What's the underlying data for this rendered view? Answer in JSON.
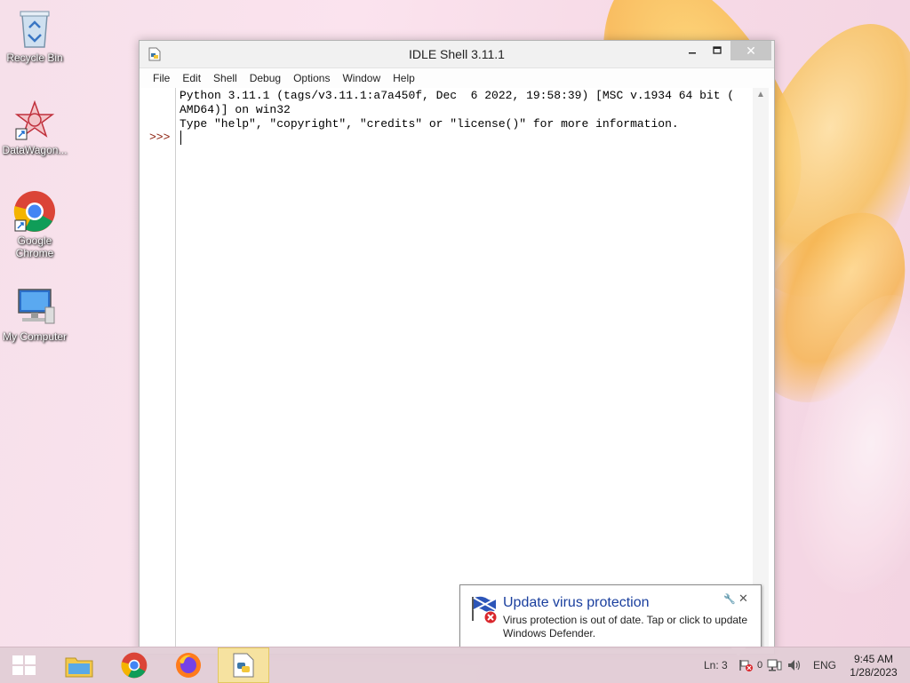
{
  "desktop": {
    "icons": [
      {
        "label": "Recycle Bin"
      },
      {
        "label": "DataWagon..."
      },
      {
        "label": "Google Chrome"
      },
      {
        "label": "My Computer"
      }
    ]
  },
  "window": {
    "title": "IDLE Shell 3.11.1",
    "menu": [
      "File",
      "Edit",
      "Shell",
      "Debug",
      "Options",
      "Window",
      "Help"
    ],
    "lines": [
      "Python 3.11.1 (tags/v3.11.1:a7a450f, Dec  6 2022, 19:58:39) [MSC v.1934 64 bit (",
      "AMD64)] on win32",
      "Type \"help\", \"copyright\", \"credits\" or \"license()\" for more information."
    ],
    "prompt": ">>>"
  },
  "notification": {
    "title": "Update virus protection",
    "body": "Virus protection is out of date. Tap or click to update Windows Defender."
  },
  "taskbar": {
    "status_text": "Ln: 3",
    "tray_count": "0",
    "language": "ENG",
    "time": "9:45 AM",
    "date": "1/28/2023"
  },
  "colors": {
    "prompt": "#8b1e0b",
    "notification_title": "#1a3f9e",
    "active_task": "#f6e2a0"
  }
}
